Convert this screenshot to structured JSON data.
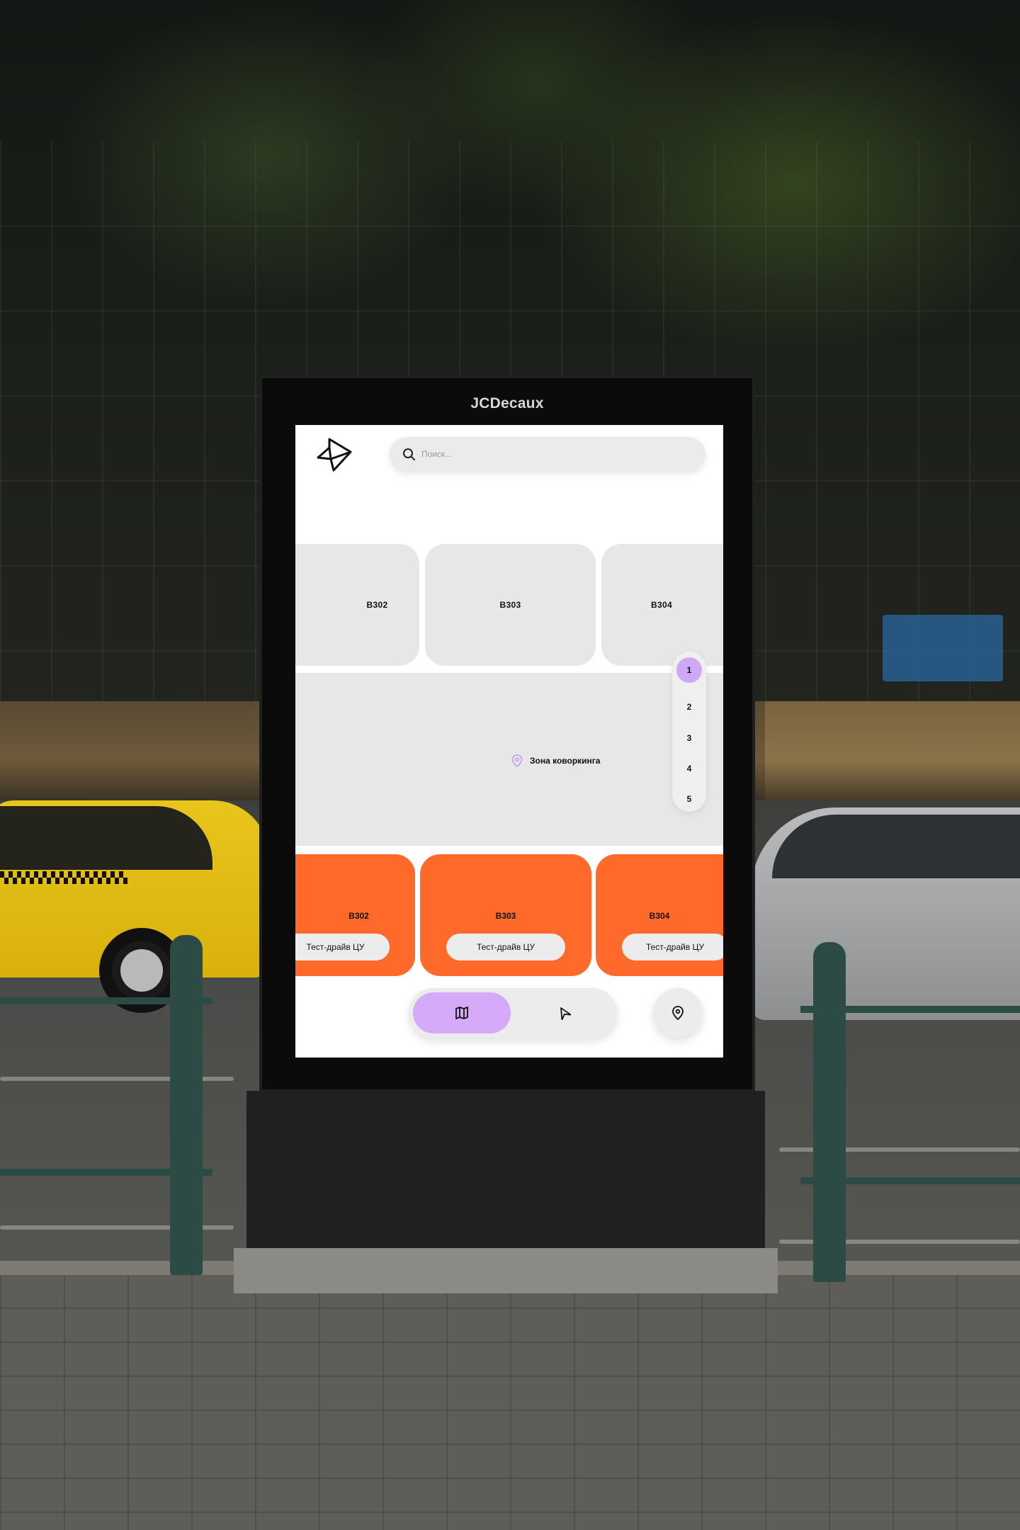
{
  "kiosk": {
    "brand": "JCDecaux"
  },
  "app": {
    "search": {
      "placeholder": "Поиск..."
    },
    "rooms_top": [
      {
        "label": "B302"
      },
      {
        "label": "B303"
      },
      {
        "label": "B304"
      }
    ],
    "coworking": {
      "label": "Зона коворкинга"
    },
    "floors": [
      "1",
      "2",
      "3",
      "4",
      "5"
    ],
    "active_floor": "1",
    "rooms_bottom": [
      {
        "label": "B302",
        "button": "Тест-драйв ЦУ"
      },
      {
        "label": "B303",
        "button": "Тест-драйв ЦУ"
      },
      {
        "label": "B304",
        "button": "Тест-драйв ЦУ"
      }
    ],
    "nav": {
      "map_icon": "map-icon",
      "route_icon": "navigation-icon",
      "locate_icon": "location-pin-icon"
    },
    "colors": {
      "accent_purple": "#d5aaf9",
      "room_orange": "#ff6a2a",
      "room_grey": "#e7e7e7"
    }
  }
}
